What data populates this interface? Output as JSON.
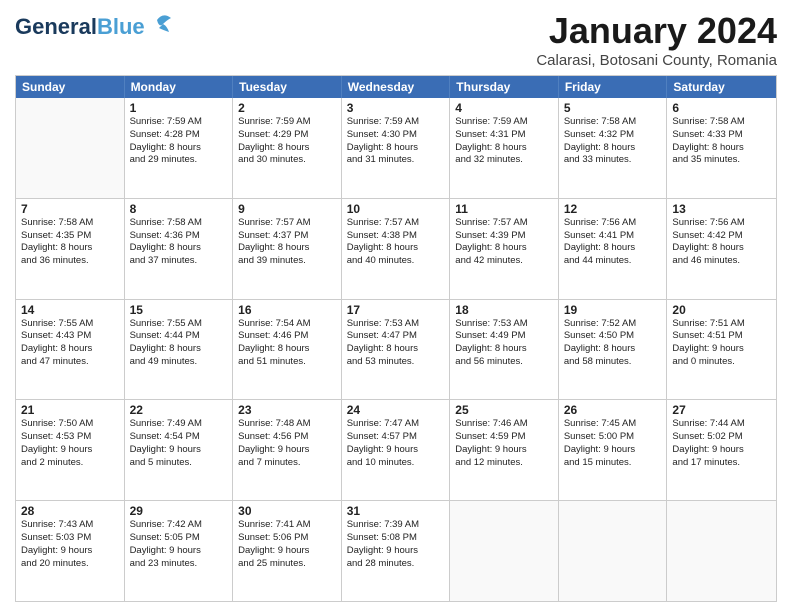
{
  "app": {
    "logo_general": "General",
    "logo_blue": "Blue",
    "title": "January 2024",
    "subtitle": "Calarasi, Botosani County, Romania"
  },
  "calendar": {
    "headers": [
      "Sunday",
      "Monday",
      "Tuesday",
      "Wednesday",
      "Thursday",
      "Friday",
      "Saturday"
    ],
    "rows": [
      [
        {
          "day": "",
          "lines": [],
          "empty": true
        },
        {
          "day": "1",
          "lines": [
            "Sunrise: 7:59 AM",
            "Sunset: 4:28 PM",
            "Daylight: 8 hours",
            "and 29 minutes."
          ]
        },
        {
          "day": "2",
          "lines": [
            "Sunrise: 7:59 AM",
            "Sunset: 4:29 PM",
            "Daylight: 8 hours",
            "and 30 minutes."
          ]
        },
        {
          "day": "3",
          "lines": [
            "Sunrise: 7:59 AM",
            "Sunset: 4:30 PM",
            "Daylight: 8 hours",
            "and 31 minutes."
          ]
        },
        {
          "day": "4",
          "lines": [
            "Sunrise: 7:59 AM",
            "Sunset: 4:31 PM",
            "Daylight: 8 hours",
            "and 32 minutes."
          ]
        },
        {
          "day": "5",
          "lines": [
            "Sunrise: 7:58 AM",
            "Sunset: 4:32 PM",
            "Daylight: 8 hours",
            "and 33 minutes."
          ]
        },
        {
          "day": "6",
          "lines": [
            "Sunrise: 7:58 AM",
            "Sunset: 4:33 PM",
            "Daylight: 8 hours",
            "and 35 minutes."
          ]
        }
      ],
      [
        {
          "day": "7",
          "lines": [
            "Sunrise: 7:58 AM",
            "Sunset: 4:35 PM",
            "Daylight: 8 hours",
            "and 36 minutes."
          ]
        },
        {
          "day": "8",
          "lines": [
            "Sunrise: 7:58 AM",
            "Sunset: 4:36 PM",
            "Daylight: 8 hours",
            "and 37 minutes."
          ]
        },
        {
          "day": "9",
          "lines": [
            "Sunrise: 7:57 AM",
            "Sunset: 4:37 PM",
            "Daylight: 8 hours",
            "and 39 minutes."
          ]
        },
        {
          "day": "10",
          "lines": [
            "Sunrise: 7:57 AM",
            "Sunset: 4:38 PM",
            "Daylight: 8 hours",
            "and 40 minutes."
          ]
        },
        {
          "day": "11",
          "lines": [
            "Sunrise: 7:57 AM",
            "Sunset: 4:39 PM",
            "Daylight: 8 hours",
            "and 42 minutes."
          ]
        },
        {
          "day": "12",
          "lines": [
            "Sunrise: 7:56 AM",
            "Sunset: 4:41 PM",
            "Daylight: 8 hours",
            "and 44 minutes."
          ]
        },
        {
          "day": "13",
          "lines": [
            "Sunrise: 7:56 AM",
            "Sunset: 4:42 PM",
            "Daylight: 8 hours",
            "and 46 minutes."
          ]
        }
      ],
      [
        {
          "day": "14",
          "lines": [
            "Sunrise: 7:55 AM",
            "Sunset: 4:43 PM",
            "Daylight: 8 hours",
            "and 47 minutes."
          ]
        },
        {
          "day": "15",
          "lines": [
            "Sunrise: 7:55 AM",
            "Sunset: 4:44 PM",
            "Daylight: 8 hours",
            "and 49 minutes."
          ]
        },
        {
          "day": "16",
          "lines": [
            "Sunrise: 7:54 AM",
            "Sunset: 4:46 PM",
            "Daylight: 8 hours",
            "and 51 minutes."
          ]
        },
        {
          "day": "17",
          "lines": [
            "Sunrise: 7:53 AM",
            "Sunset: 4:47 PM",
            "Daylight: 8 hours",
            "and 53 minutes."
          ]
        },
        {
          "day": "18",
          "lines": [
            "Sunrise: 7:53 AM",
            "Sunset: 4:49 PM",
            "Daylight: 8 hours",
            "and 56 minutes."
          ]
        },
        {
          "day": "19",
          "lines": [
            "Sunrise: 7:52 AM",
            "Sunset: 4:50 PM",
            "Daylight: 8 hours",
            "and 58 minutes."
          ]
        },
        {
          "day": "20",
          "lines": [
            "Sunrise: 7:51 AM",
            "Sunset: 4:51 PM",
            "Daylight: 9 hours",
            "and 0 minutes."
          ]
        }
      ],
      [
        {
          "day": "21",
          "lines": [
            "Sunrise: 7:50 AM",
            "Sunset: 4:53 PM",
            "Daylight: 9 hours",
            "and 2 minutes."
          ]
        },
        {
          "day": "22",
          "lines": [
            "Sunrise: 7:49 AM",
            "Sunset: 4:54 PM",
            "Daylight: 9 hours",
            "and 5 minutes."
          ]
        },
        {
          "day": "23",
          "lines": [
            "Sunrise: 7:48 AM",
            "Sunset: 4:56 PM",
            "Daylight: 9 hours",
            "and 7 minutes."
          ]
        },
        {
          "day": "24",
          "lines": [
            "Sunrise: 7:47 AM",
            "Sunset: 4:57 PM",
            "Daylight: 9 hours",
            "and 10 minutes."
          ]
        },
        {
          "day": "25",
          "lines": [
            "Sunrise: 7:46 AM",
            "Sunset: 4:59 PM",
            "Daylight: 9 hours",
            "and 12 minutes."
          ]
        },
        {
          "day": "26",
          "lines": [
            "Sunrise: 7:45 AM",
            "Sunset: 5:00 PM",
            "Daylight: 9 hours",
            "and 15 minutes."
          ]
        },
        {
          "day": "27",
          "lines": [
            "Sunrise: 7:44 AM",
            "Sunset: 5:02 PM",
            "Daylight: 9 hours",
            "and 17 minutes."
          ]
        }
      ],
      [
        {
          "day": "28",
          "lines": [
            "Sunrise: 7:43 AM",
            "Sunset: 5:03 PM",
            "Daylight: 9 hours",
            "and 20 minutes."
          ]
        },
        {
          "day": "29",
          "lines": [
            "Sunrise: 7:42 AM",
            "Sunset: 5:05 PM",
            "Daylight: 9 hours",
            "and 23 minutes."
          ]
        },
        {
          "day": "30",
          "lines": [
            "Sunrise: 7:41 AM",
            "Sunset: 5:06 PM",
            "Daylight: 9 hours",
            "and 25 minutes."
          ]
        },
        {
          "day": "31",
          "lines": [
            "Sunrise: 7:39 AM",
            "Sunset: 5:08 PM",
            "Daylight: 9 hours",
            "and 28 minutes."
          ]
        },
        {
          "day": "",
          "lines": [],
          "empty": true
        },
        {
          "day": "",
          "lines": [],
          "empty": true
        },
        {
          "day": "",
          "lines": [],
          "empty": true
        }
      ]
    ]
  }
}
